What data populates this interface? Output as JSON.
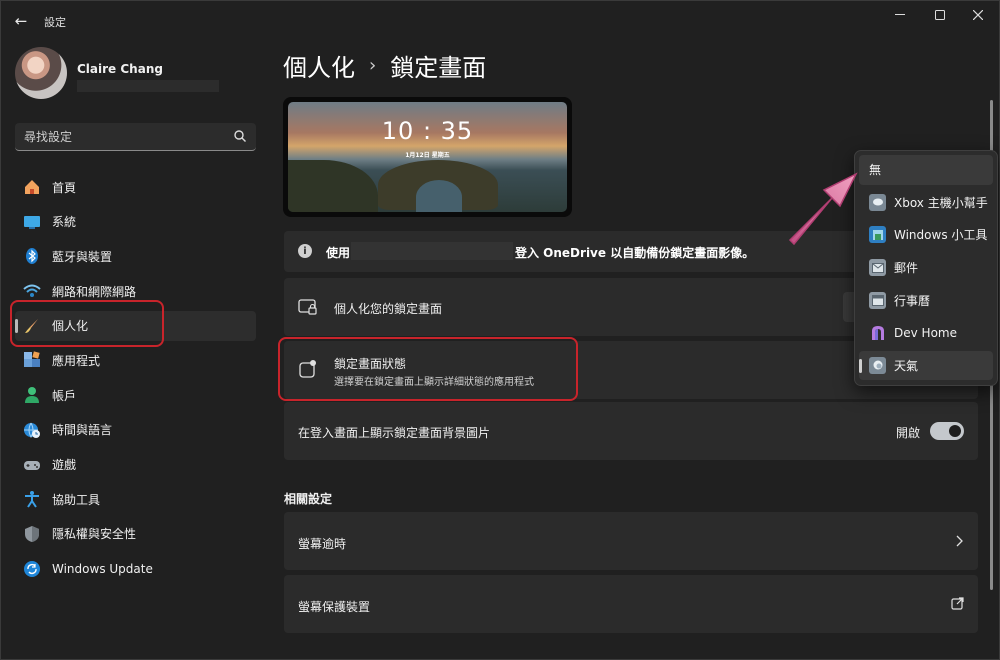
{
  "window": {
    "app_title": "設定",
    "minimize_glyph": "—",
    "maximize_glyph": "☐",
    "close_glyph": "✕",
    "back_glyph": "←"
  },
  "user": {
    "name": "Claire Chang"
  },
  "search": {
    "placeholder": "尋找設定"
  },
  "nav": {
    "items": [
      {
        "label": "首頁",
        "icon": "home-icon"
      },
      {
        "label": "系統",
        "icon": "monitor-icon"
      },
      {
        "label": "藍牙與裝置",
        "icon": "bluetooth-icon"
      },
      {
        "label": "網路和網際網路",
        "icon": "wifi-icon"
      },
      {
        "label": "個人化",
        "icon": "brush-icon",
        "active": true
      },
      {
        "label": "應用程式",
        "icon": "apps-icon"
      },
      {
        "label": "帳戶",
        "icon": "person-icon"
      },
      {
        "label": "時間與語言",
        "icon": "globe-clock-icon"
      },
      {
        "label": "遊戲",
        "icon": "gamepad-icon"
      },
      {
        "label": "協助工具",
        "icon": "accessibility-icon"
      },
      {
        "label": "隱私權與安全性",
        "icon": "shield-icon"
      },
      {
        "label": "Windows Update",
        "icon": "update-icon"
      }
    ]
  },
  "header": {
    "parent": "個人化",
    "separator": "›",
    "current": "鎖定畫面"
  },
  "preview": {
    "time": "10 : 35",
    "date": "1月12日 星期五"
  },
  "info_bar": {
    "prefix": "使用",
    "suffix": "登入 OneDrive 以自動備份鎖定畫面影像。"
  },
  "settings": {
    "personalize_lock": {
      "label": "個人化您的鎖定畫面"
    },
    "lock_status": {
      "label": "鎖定畫面狀態",
      "description": "選擇要在鎖定畫面上顯示詳細狀態的應用程式"
    },
    "signin_background": {
      "label": "在登入畫面上顯示鎖定畫面背景圖片",
      "state_label": "開啟",
      "on": true
    }
  },
  "related": {
    "heading": "相關設定",
    "items": [
      {
        "label": "螢幕逾時",
        "action": "chevron-right-icon"
      },
      {
        "label": "螢幕保護裝置",
        "action": "external-link-icon"
      }
    ]
  },
  "dropdown": {
    "options": [
      {
        "label": "無",
        "icon": ""
      },
      {
        "label": "Xbox 主機小幫手",
        "icon": "xbox-icon"
      },
      {
        "label": "Windows 小工具",
        "icon": "widgets-icon"
      },
      {
        "label": "郵件",
        "icon": "mail-icon"
      },
      {
        "label": "行事曆",
        "icon": "calendar-icon"
      },
      {
        "label": "Dev Home",
        "icon": "dev-home-icon"
      },
      {
        "label": "天氣",
        "icon": "weather-icon",
        "selected": true
      }
    ]
  },
  "colors": {
    "background": "#202020",
    "card": "#2b2b2b",
    "highlight_box": "#c8242b",
    "arrow": "#d9709a",
    "toggle_on": "#c4c8cc"
  }
}
